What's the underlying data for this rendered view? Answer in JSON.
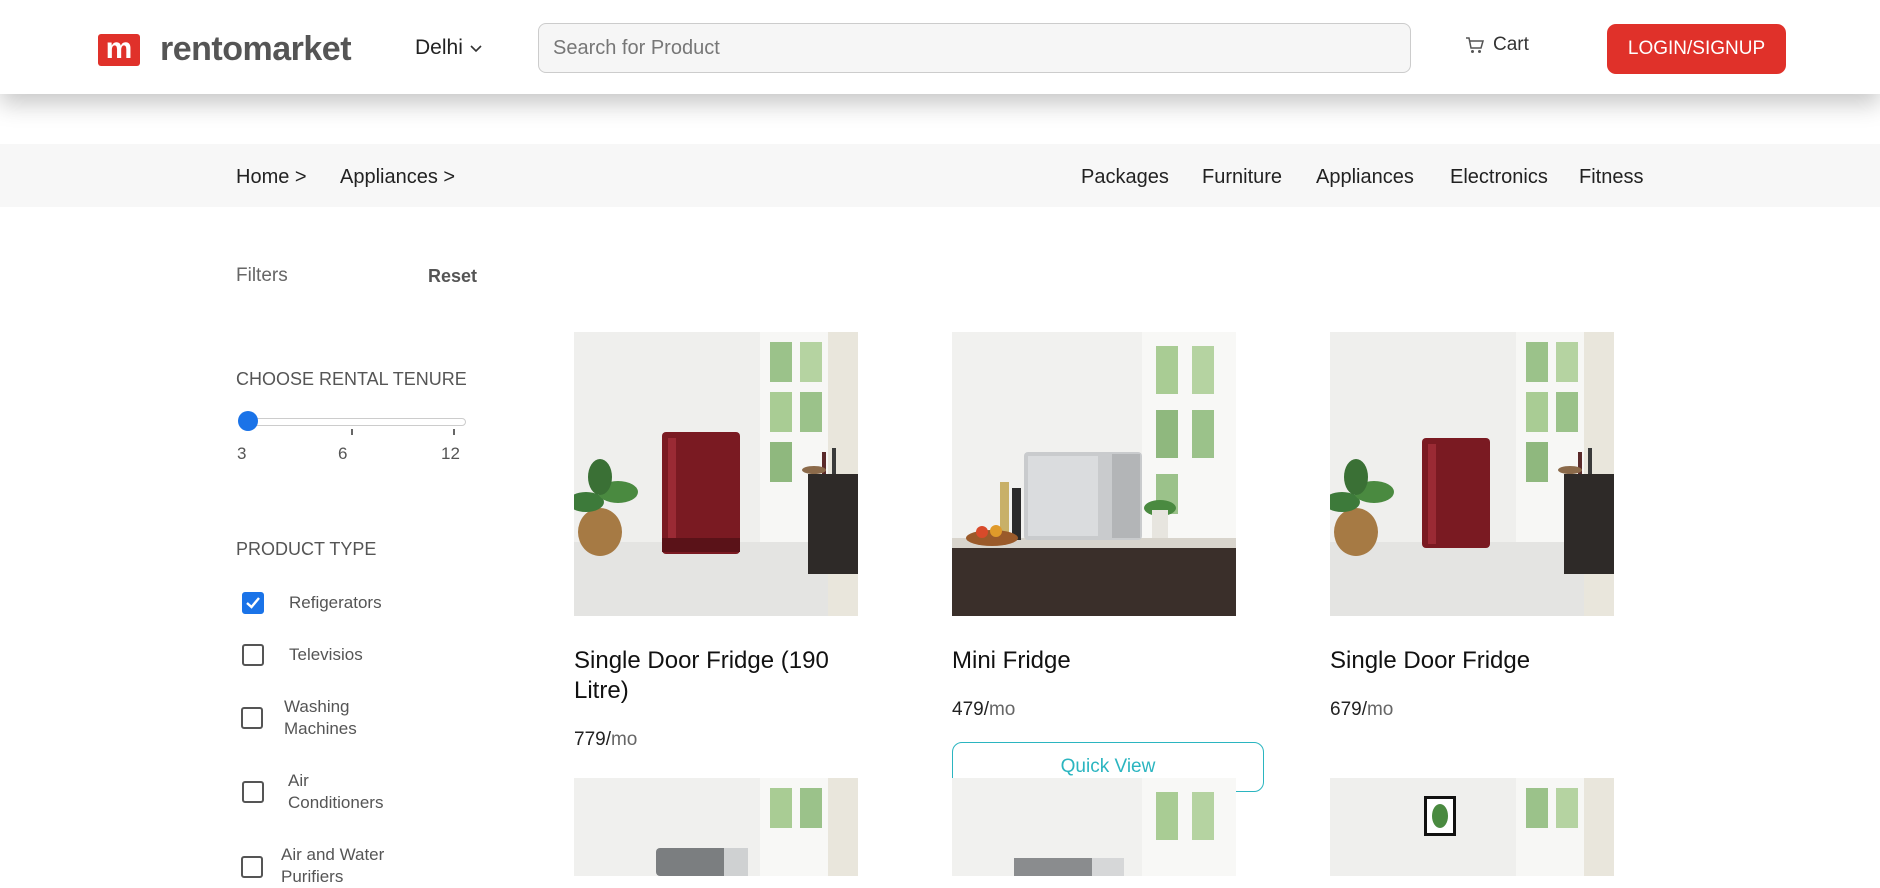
{
  "header": {
    "logo_mark": "m",
    "logo_text": "rentomarket",
    "city": "Delhi",
    "search_placeholder": "Search for Product",
    "cart_label": "Cart",
    "login_label": "LOGIN/SIGNUP"
  },
  "breadcrumb": [
    "Home >",
    "Appliances >"
  ],
  "categories": [
    "Packages",
    "Furniture",
    "Appliances",
    "Electronics",
    "Fitness"
  ],
  "filters": {
    "label": "Filters",
    "reset": "Reset",
    "tenure_title": "CHOOSE RENTAL TENURE",
    "tenure_ticks": [
      "3",
      "6",
      "12"
    ],
    "tenure_selected": 3,
    "product_type_title": "PRODUCT TYPE",
    "product_types": [
      {
        "label": "Refigerators",
        "checked": true
      },
      {
        "label": "Televisios",
        "checked": false
      },
      {
        "label": "Washing Machines",
        "checked": false
      },
      {
        "label": "Air Conditioners",
        "checked": false
      },
      {
        "label": "Air and Water Purifiers",
        "checked": false
      }
    ]
  },
  "products": [
    {
      "title": "Single Door Fridge (190 Litre)",
      "price": "779/",
      "per": "mo",
      "image_icon": "red-fridge-image"
    },
    {
      "title": "Mini Fridge",
      "price": "479/",
      "per": "mo",
      "image_icon": "mini-fridge-image"
    },
    {
      "title": "Single Door Fridge",
      "price": "679/",
      "per": "mo",
      "image_icon": "red-fridge-image"
    }
  ],
  "quick_view_label": "Quick View",
  "colors": {
    "brand": "#e0312a",
    "accent": "#2bb5c0",
    "slider": "#1a73e8"
  }
}
